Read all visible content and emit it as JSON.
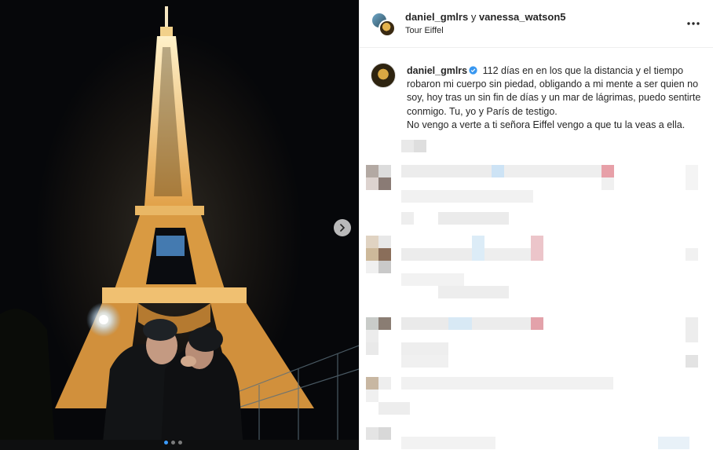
{
  "post": {
    "image_alt": "Couple kissing in front of the illuminated Eiffel Tower at night",
    "carousel": {
      "count": 3,
      "active": 0
    }
  },
  "header": {
    "user1": "daniel_gmlrs",
    "joiner": "y",
    "user2": "vanessa_watson5",
    "location": "Tour Eiffel"
  },
  "caption": {
    "username": "daniel_gmlrs",
    "text": "112 días en en los que la distancia y el tiempo robaron mi cuerpo sin piedad, obligando a mi mente a ser quien no soy, hoy tras un sin fin de días y un mar de lágrimas, puedo sentirte conmigo. Tu, yo y París de testigo.",
    "line2": "No vengo a verte a ti señora Eiffel vengo a que tu la veas a ella."
  },
  "colors": {
    "accent": "#3897f0",
    "text": "#262626",
    "divider": "#efefef"
  }
}
